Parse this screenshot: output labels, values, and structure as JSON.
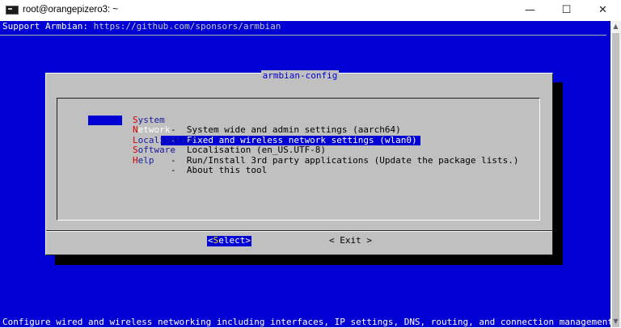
{
  "window": {
    "title": "root@orangepizero3: ~",
    "controls": {
      "minimize": "—",
      "maximize": "☐",
      "close": "✕"
    }
  },
  "terminal": {
    "support_label": "Support Armbian: ",
    "support_url": "https://github.com/sponsors/armbian",
    "status_line": "Configure wired and wireless networking including interfaces, IP settings, DNS, routing, and connection management."
  },
  "dialog": {
    "title": "armbian-config",
    "items": [
      {
        "key": "S",
        "rest": "ystem",
        "desc": "-  System wide and admin settings (aarch64)",
        "selected": false
      },
      {
        "key": "N",
        "rest": "etwork",
        "desc": "-  Fixed and wireless network settings (wlan0)",
        "selected": true
      },
      {
        "key": "L",
        "rest": "ocalisation",
        "desc": "-  Localisation (en_US.UTF-8)",
        "selected": false
      },
      {
        "key": "S",
        "rest": "oftware",
        "desc": "-  Run/Install 3rd party applications (Update the package lists.)",
        "selected": false
      },
      {
        "key": "H",
        "rest": "elp",
        "desc": "-  About this tool",
        "selected": false
      }
    ],
    "select_button": {
      "open": "<",
      "key": "S",
      "rest": "elect",
      "close": ">"
    },
    "exit_button": "< Exit >"
  },
  "colors": {
    "terminal_bg": "#0000d4",
    "dialog_bg": "#c0c0c0",
    "hotkey": "#d00000"
  }
}
